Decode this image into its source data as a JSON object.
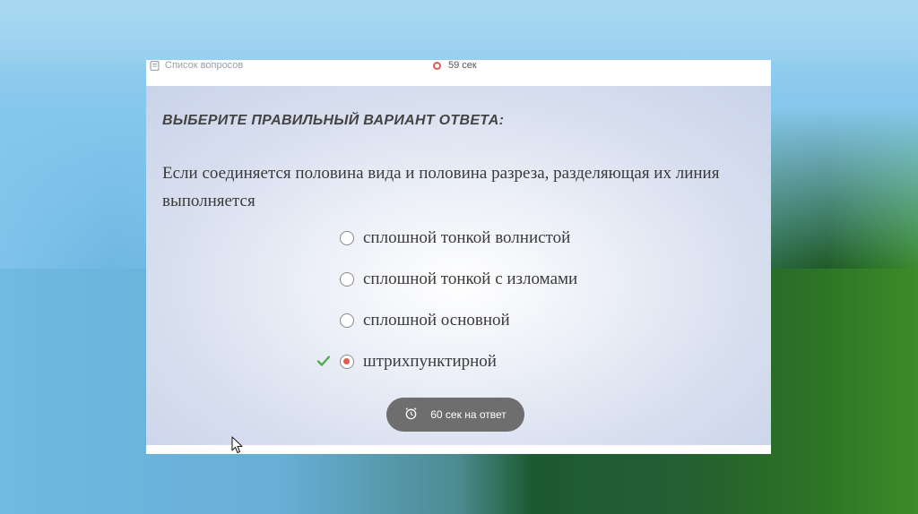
{
  "topbar": {
    "questions_label": "Список вопросов",
    "timer_label": "59 сек"
  },
  "quiz": {
    "heading": "ВЫБЕРИТЕ ПРАВИЛЬНЫЙ ВАРИАНТ ОТВЕТА:",
    "question": "Если соединяется половина вида и половина разреза, разделяющая их линия выполняется",
    "options": [
      {
        "label": "сплошной тонкой волнистой",
        "selected": false
      },
      {
        "label": "сплошной тонкой с изломами",
        "selected": false
      },
      {
        "label": "сплошной основной",
        "selected": false
      },
      {
        "label": "штрихпунктирной",
        "selected": true,
        "correct": true
      }
    ],
    "answer_timer_label": "60 сек на ответ"
  },
  "colors": {
    "selected_dot": "#e35a50",
    "correct_check": "#4caf50",
    "timer_ring": "#e05a55",
    "timer_pill": "#6e6e6e"
  },
  "icons": [
    "list-icon",
    "timer-ring-icon",
    "check-icon",
    "alarm-clock-icon",
    "mouse-cursor-icon"
  ]
}
